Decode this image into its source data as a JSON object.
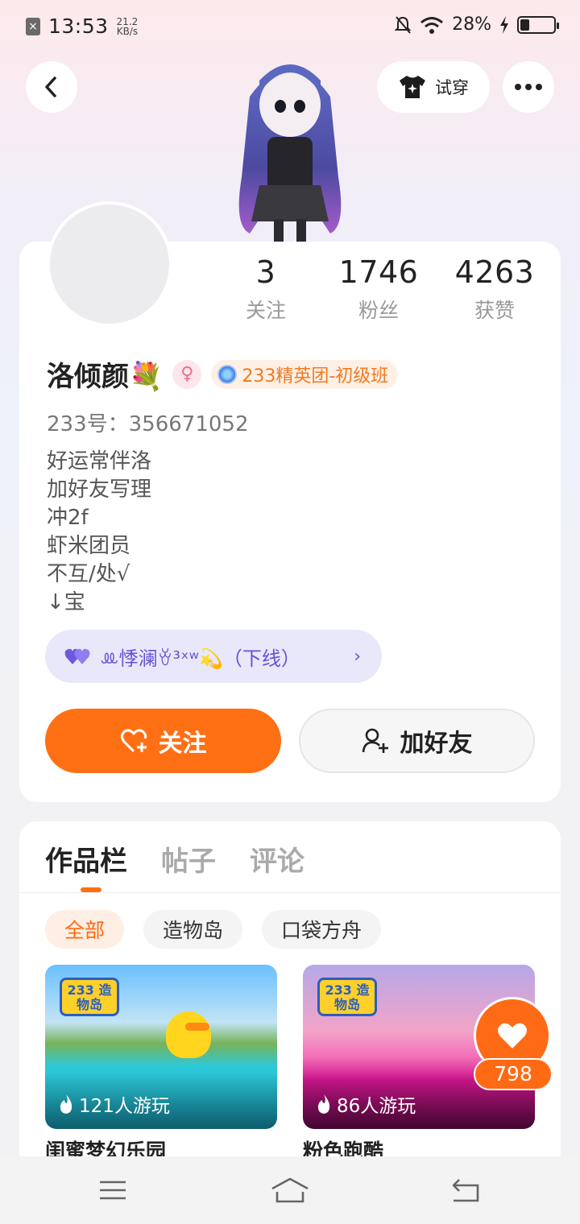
{
  "status_bar": {
    "time": "13:53",
    "net_speed": "21.2",
    "net_unit": "KB/s",
    "battery": "28%",
    "battery_level": 0.28
  },
  "header": {
    "try_on_label": "试穿"
  },
  "profile": {
    "stats": [
      {
        "value": "3",
        "label": "关注"
      },
      {
        "value": "1746",
        "label": "粉丝"
      },
      {
        "value": "4263",
        "label": "获赞"
      }
    ],
    "name": "洛倾颜💐",
    "gender_symbol": "♀",
    "badge": "233精英团-初级班",
    "id_line": "233号：356671052",
    "bio": [
      "好运常伴洛",
      "加好友写理",
      "冲2f",
      "虾米团员",
      "不互/处√",
      "↓宝"
    ],
    "partner": {
      "text": "ꔛ悸澜ꈊ³ˣʷ💫（下线）",
      "chevron": "›"
    },
    "follow_label": "关注",
    "add_friend_label": "加好友"
  },
  "works": {
    "tabs": [
      "作品栏",
      "帖子",
      "评论"
    ],
    "active_tab": 0,
    "chips": [
      "全部",
      "造物岛",
      "口袋方舟"
    ],
    "active_chip": 0,
    "games": [
      {
        "logo": "233 造物岛",
        "plays": "121人游玩",
        "title": "闺蜜梦幻乐园"
      },
      {
        "logo": "233 造物岛",
        "plays": "86人游玩",
        "title": "粉色跑酷"
      }
    ]
  },
  "like_float": {
    "count": "798"
  },
  "colors": {
    "accent": "#ff7014",
    "partner_pill": "#e9e8fb",
    "partner_text": "#6553d6"
  },
  "icons": {
    "back": "chevron-left-icon",
    "try_on": "tshirt-sparkle-icon",
    "more": "more-dots-icon",
    "follow": "heart-plus-icon",
    "add_friend": "user-plus-icon",
    "plays": "flame-icon",
    "like": "heart-icon",
    "nav_menu": "menu-icon",
    "nav_home": "home-icon",
    "nav_back": "return-icon"
  }
}
